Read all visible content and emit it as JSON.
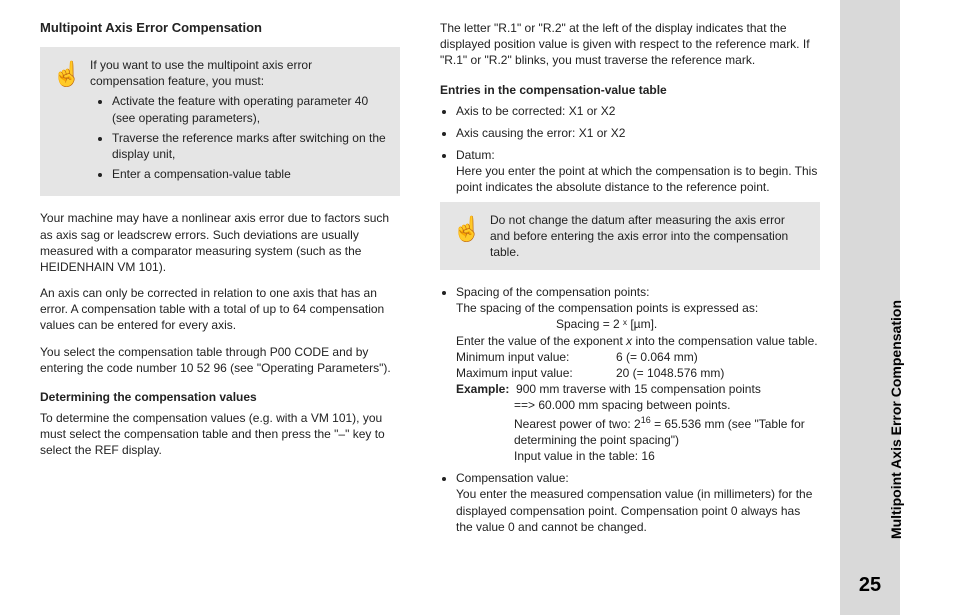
{
  "side": {
    "title": "Multipoint Axis Error Compensation",
    "page": "25"
  },
  "left": {
    "heading": "Multipoint Axis Error Compensation",
    "note_intro": "If you want to use the multipoint axis error compensation feature, you must:",
    "note_b1": "Activate the feature with operating parameter 40 (see  operating parameters),",
    "note_b2": "Traverse the reference marks after switching on the display unit,",
    "note_b3": "Enter a compensation-value table",
    "p1": "Your machine may have a nonlinear axis error due to factors such as axis sag or leadscrew errors. Such deviations are usually measured with a comparator measuring system (such as the HEIDENHAIN VM 101).",
    "p2a": "An axis can only be corrected in relation to ",
    "p2_one": "one",
    "p2b": " axis that has an error.  A compensation table with a total of up to 64 compensation values can be entered for every axis.",
    "p3": "You select the compensation table through P00 CODE and by entering the code number 10 52 96 (see \"Operating Parameters\").",
    "h2": "Determining the compensation values",
    "p4": "To determine the compensation values (e.g. with a VM 101), you must select the compensation table and then press the \"–\" key to select the REF display."
  },
  "right": {
    "p1": "The letter \"R.1\" or \"R.2\" at the left of the display indicates that the displayed position value is given with respect to the reference mark. If \"R.1\" or \"R.2\" blinks, you must traverse the reference mark.",
    "h2": "Entries in the compensation-value table",
    "b1": "Axis to be corrected: X1 or X2",
    "b2": "Axis causing the error: X1 or X2",
    "b3a": "Datum:",
    "b3b": "Here you enter the point at which the compensation is to begin. This point indicates the absolute distance to the reference point.",
    "note2": "Do not change the datum after measuring the axis error and before entering the axis error into the compensation table.",
    "b4a": "Spacing of the compensation points:",
    "b4b": "The spacing of the compensation points is expressed as:",
    "b4c": "Spacing = 2 ˣ [µm].",
    "b4d_a": "Enter the value of the exponent ",
    "b4d_x": "x",
    "b4d_b": " into the compensation value table.",
    "min_k": "Minimum input value:",
    "min_v": "6 (= 0.064 mm)",
    "max_k": "Maximum input value:",
    "max_v": "20 (= 1048.576 mm)",
    "ex_label": "Example:",
    "ex1": "900 mm traverse with 15 compensation points",
    "ex2": "==> 60.000 mm spacing between points.",
    "ex3a": "Nearest power of two: 2",
    "ex3sup": "16",
    "ex3b": " = 65.536 mm (see \"Table for determining the point spacing\")",
    "ex4": "Input value in the table: 16",
    "b5a": "Compensation value:",
    "b5b": "You enter the measured compensation value (in millimeters) for the displayed compensation point. Compensation point 0 always has the value 0 and cannot be changed."
  }
}
